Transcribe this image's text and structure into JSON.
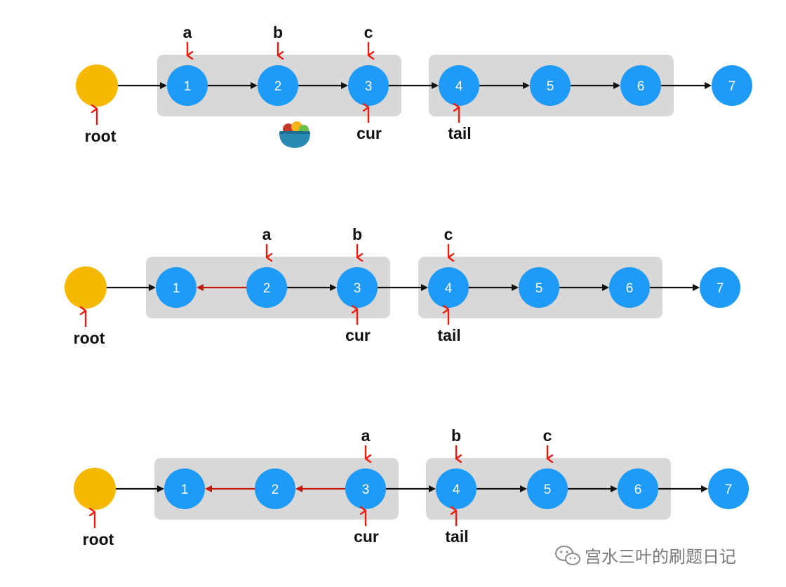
{
  "diagram": {
    "colors": {
      "node": "#1e9bf7",
      "root": "#f7b900",
      "group": "#d8d8d8",
      "arrow": "#111111",
      "reversed_arrow": "#c0190e",
      "pointer": "#ee1c0e",
      "watermark": "#8c8c8c"
    },
    "root_label": "root",
    "rows": [
      {
        "nodes": [
          "1",
          "2",
          "3",
          "4",
          "5",
          "6",
          "7"
        ],
        "reversed": [],
        "pointers_above": {
          "a": "1",
          "b": "2",
          "c": "3"
        },
        "pointers_below": {
          "cur": "3",
          "tail": "4"
        },
        "groups": [
          [
            "1",
            "3"
          ],
          [
            "4",
            "6"
          ]
        ]
      },
      {
        "nodes": [
          "1",
          "2",
          "3",
          "4",
          "5",
          "6",
          "7"
        ],
        "reversed": [
          "2->1"
        ],
        "pointers_above": {
          "a": "2",
          "b": "3",
          "c": "4"
        },
        "pointers_below": {
          "cur": "3",
          "tail": "4"
        },
        "groups": [
          [
            "1",
            "3"
          ],
          [
            "4",
            "6"
          ]
        ]
      },
      {
        "nodes": [
          "1",
          "2",
          "3",
          "4",
          "5",
          "6",
          "7"
        ],
        "reversed": [
          "2->1",
          "3->2"
        ],
        "pointers_above": {
          "a": "3",
          "b": "4",
          "c": "5"
        },
        "pointers_below": {
          "cur": "3",
          "tail": "4"
        },
        "groups": [
          [
            "1",
            "3"
          ],
          [
            "4",
            "6"
          ]
        ]
      }
    ],
    "decoration_icon": "fruit-bowl-icon",
    "watermark": {
      "icon": "wechat-icon",
      "text": "宫水三叶的刷题日记"
    }
  }
}
